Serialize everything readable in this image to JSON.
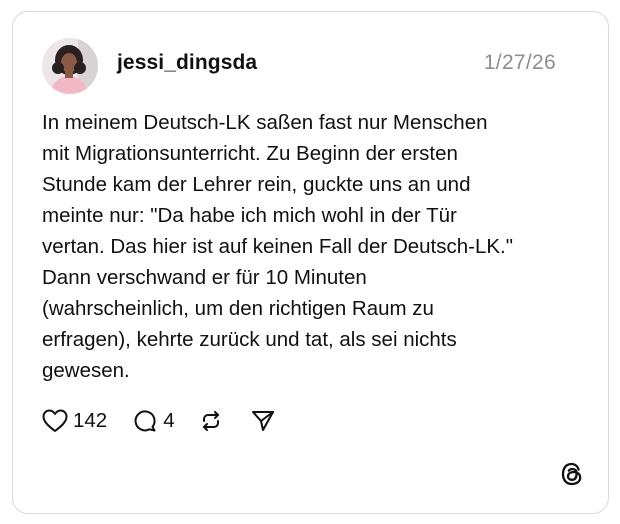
{
  "post": {
    "username": "jessi_dingsda",
    "date": "1/27/26",
    "text_lines": [
      "In meinem Deutsch-LK saßen fast nur Menschen",
      "mit Migrationsunterricht. Zu Beginn der ersten",
      "Stunde kam der Lehrer rein, guckte uns an und",
      "meinte nur: \"Da habe ich mich wohl in der Tür",
      "vertan. Das hier ist auf keinen Fall der Deutsch-LK.\"",
      "Dann verschwand er für 10 Minuten",
      "(wahrscheinlich, um den richtigen Raum zu",
      "erfragen), kehrte zurück und tat, als sei nichts",
      "gewesen."
    ]
  },
  "actions": {
    "like_icon": "heart-icon",
    "like_count": "142",
    "reply_icon": "comment-icon",
    "reply_count": "4",
    "repost_icon": "repost-icon",
    "share_icon": "send-icon"
  },
  "branding": {
    "logo_icon": "threads-logo-icon"
  },
  "colors": {
    "text": "#111111",
    "date": "#8e8e8e",
    "border": "#d9d9d9",
    "background": "#ffffff"
  }
}
